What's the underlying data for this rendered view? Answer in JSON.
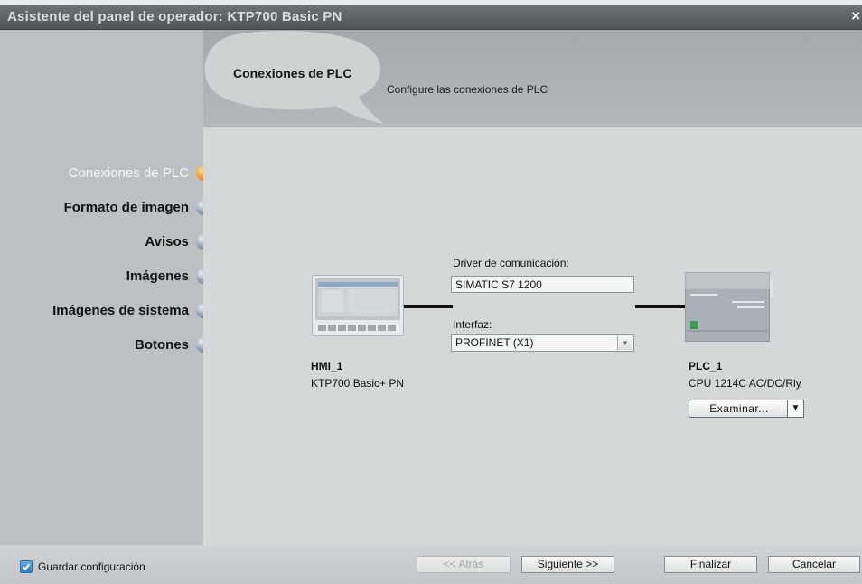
{
  "window": {
    "title": "Asistente del panel de operador: KTP700 Basic PN",
    "close_glyph": "×"
  },
  "header": {
    "bubble_title": "Conexiones de PLC",
    "subtitle": "Configure las conexiones de PLC"
  },
  "nav": [
    {
      "label": "Conexiones de PLC",
      "active": true
    },
    {
      "label": "Formato de imagen",
      "active": false
    },
    {
      "label": "Avisos",
      "active": false
    },
    {
      "label": "Imágenes",
      "active": false
    },
    {
      "label": "Imágenes de sistema",
      "active": false
    },
    {
      "label": "Botones",
      "active": false
    }
  ],
  "connection": {
    "driver_label": "Driver de comunicación:",
    "driver_value": "SIMATIC S7 1200",
    "interface_label": "Interfaz:",
    "interface_value": "PROFINET (X1)"
  },
  "hmi": {
    "name": "HMI_1",
    "model": "KTP700 Basic+ PN"
  },
  "plc": {
    "name": "PLC_1",
    "model": "CPU 1214C AC/DC/Rly",
    "browse_label": "Examinar..."
  },
  "footer": {
    "save_config_label": "Guardar configuración",
    "save_config_checked": true,
    "back_label": "<< Atrás",
    "next_label": "Siguiente >>",
    "finish_label": "Finalizar",
    "cancel_label": "Cancelar"
  },
  "colors": {
    "active_step": "#f8a232",
    "inactive_step": "#8fa0b6",
    "checkbox": "#2f7fc2"
  },
  "icons": {
    "close": "close-icon",
    "dropdown": "chevron-down-icon",
    "check": "check-icon"
  }
}
